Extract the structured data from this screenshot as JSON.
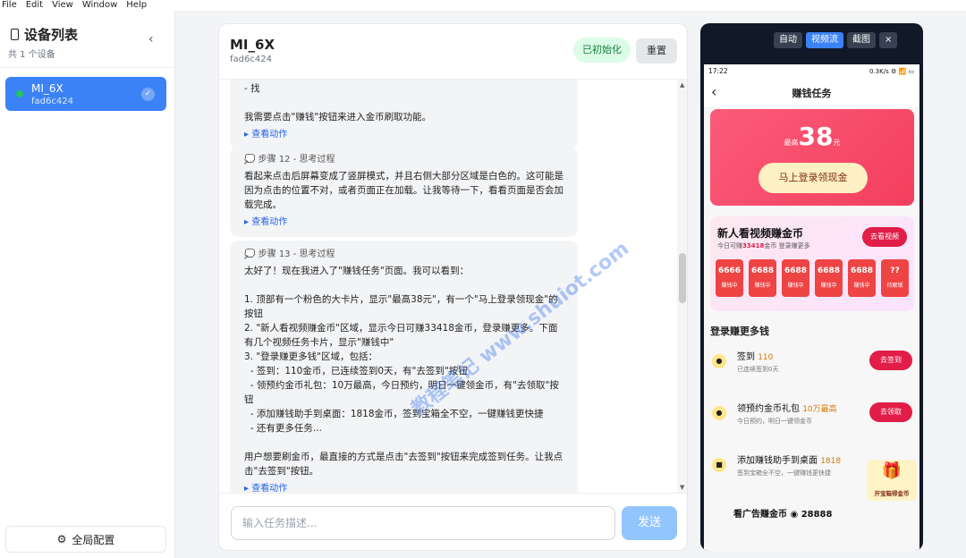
{
  "menu": [
    "File",
    "Edit",
    "View",
    "Window",
    "Help"
  ],
  "sidebar": {
    "title": "设备列表",
    "subtitle": "共 1 个设备",
    "device": {
      "name": "MI_6X",
      "serial": "fad6c424"
    },
    "footer_label": "全局配置"
  },
  "chat": {
    "device_name": "MI_6X",
    "device_serial": "fad6c424",
    "status_badge": "已初始化",
    "reset_label": "重置",
    "messages": [
      {
        "step": "",
        "lines": "- 找\n\n我需要点击\"赚钱\"按钮来进入金币刷取功能。",
        "action": "▸ 查看动作"
      },
      {
        "step": "步骤 12 - 思考过程",
        "lines": "看起来点击后屏幕变成了竖屏模式，并且右侧大部分区域是白色的。这可能是因为点击的位置不对，或者页面正在加载。让我等待一下，看看页面是否会加载完成。",
        "action": "▸ 查看动作"
      },
      {
        "step": "步骤 13 - 思考过程",
        "lines": "太好了！现在我进入了\"赚钱任务\"页面。我可以看到：\n\n1. 顶部有一个粉色的大卡片，显示\"最高38元\"，有一个\"马上登录领现金\"的按钮\n2. \"新人看视频赚金币\"区域，显示今日可赚33418金币，登录赚更多。下面有几个视频任务卡片，显示\"赚钱中\"\n3. \"登录赚更多钱\"区域，包括：\n  - 签到：110金币，已连续签到0天，有\"去签到\"按钮\n  - 领预约金币礼包：10万最高，今日预约，明日一键领金币，有\"去领取\"按钮\n  - 添加赚钱助手到桌面：1818金币，签到宝箱全不空，一键赚钱更快捷\n  - 还有更多任务...\n\n用户想要刷金币，最直接的方式是点击\"去签到\"按钮来完成签到任务。让我点击\"去签到\"按钮。",
        "action": "▸ 查看动作"
      }
    ],
    "input_placeholder": "输入任务描述...",
    "send_label": "发送"
  },
  "phone": {
    "tools": [
      "自动",
      "视频流",
      "截图",
      "×"
    ],
    "status_time": "17:22",
    "status_right": "0.3K/s ⚙ 📶 ▭",
    "nav_title": "赚钱任务",
    "card": {
      "prefix": "最高",
      "amount": "38",
      "unit": "元",
      "button": "马上登录领现金"
    },
    "video": {
      "title": "新人看视频赚金币",
      "sub_prefix": "今日可赚",
      "sub_amount": "33418",
      "sub_suffix": "金币 登录赚更多",
      "button": "去看视频",
      "coins": [
        {
          "value": "6666",
          "tag": "赚钱中"
        },
        {
          "value": "6688",
          "tag": "赚钱中"
        },
        {
          "value": "6688",
          "tag": "赚钱中"
        },
        {
          "value": "6688",
          "tag": "赚钱中"
        },
        {
          "value": "6688",
          "tag": "赚钱中"
        },
        {
          "value": "??",
          "tag": "待解锁"
        }
      ]
    },
    "section_title": "登录赚更多钱",
    "tasks": [
      {
        "name": "签到",
        "reward": "110",
        "desc": "已连续签到0天",
        "button": "去签到"
      },
      {
        "name": "领预约金币礼包",
        "reward": "10万最高",
        "desc": "今日预约，明日一键领金币",
        "button": "去领取"
      },
      {
        "name": "添加赚钱助手到桌面",
        "reward": "1818",
        "desc": "签到宝箱全不空，一键赚钱更快捷",
        "button": ""
      }
    ],
    "floating_label": "开宝箱得金币",
    "cut_task": "看广告赚金币 ◉ 28888"
  },
  "watermark": "教程笔记 www.shuiot.com",
  "colors": {
    "accent": "#3b82f6",
    "brand_red": "#e11d48",
    "success_bg": "#dcfce7"
  }
}
